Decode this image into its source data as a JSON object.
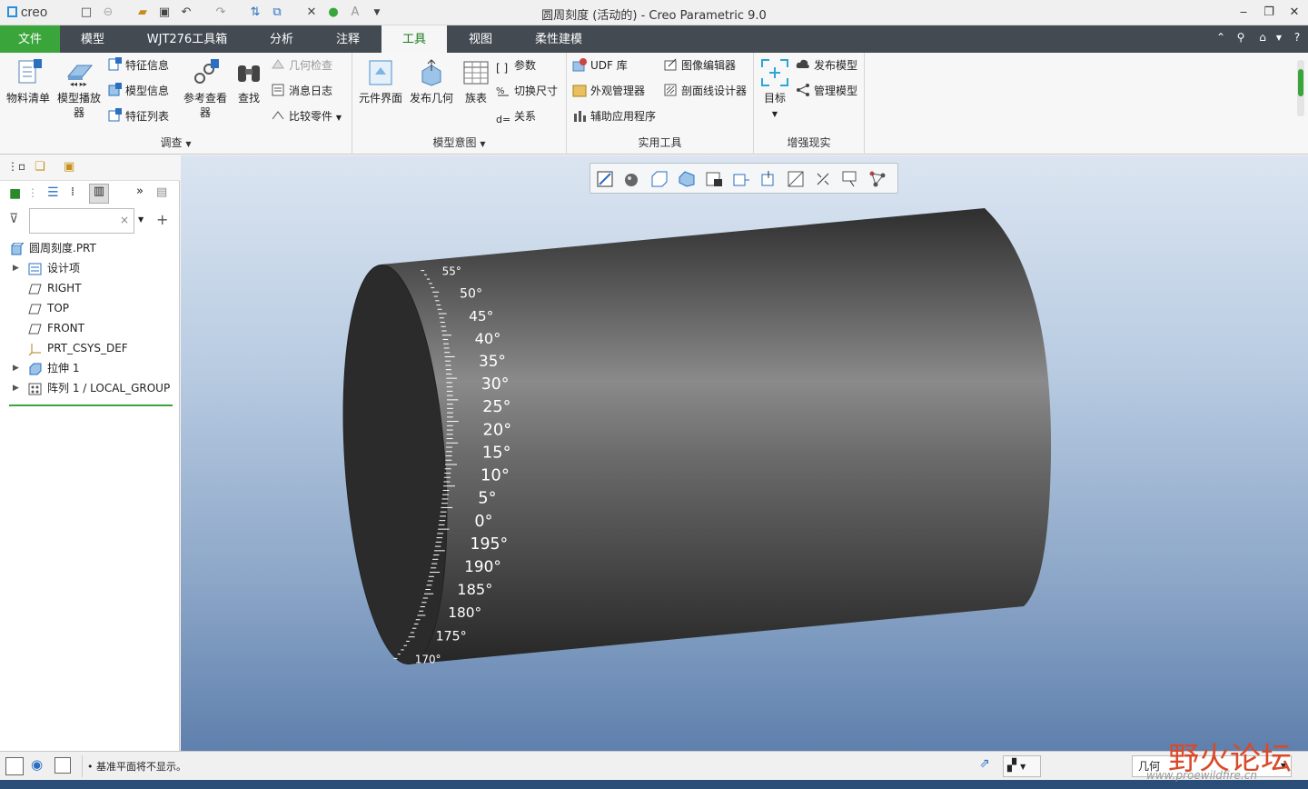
{
  "titlebar": {
    "logo": "creo",
    "title": "圆周刻度 (活动的) - Creo Parametric 9.0"
  },
  "tabs": [
    "文件",
    "模型",
    "WJT276工具箱",
    "分析",
    "注释",
    "工具",
    "视图",
    "柔性建模"
  ],
  "ribbon": {
    "investigate": {
      "label": "调查",
      "bom": "物料清单",
      "player": "模型播放器",
      "feature_info": "特征信息",
      "model_info": "模型信息",
      "feature_list": "特征列表",
      "ref_viewer": "参考查看器",
      "find": "查找",
      "geom_check": "几何检查",
      "msg_log": "消息日志",
      "compare": "比较零件"
    },
    "model_intent": {
      "label": "模型意图",
      "component_interface": "元件界面",
      "publish_geom": "发布几何",
      "family_table": "族表",
      "params": "参数",
      "switch_dims": "切换尺寸",
      "relations": "关系"
    },
    "utilities": {
      "label": "实用工具",
      "udf": "UDF 库",
      "appearance": "外观管理器",
      "aux_apps": "辅助应用程序",
      "image_editor": "图像编辑器",
      "xhatch": "剖面线设计器"
    },
    "ar": {
      "label": "增强现实",
      "target": "目标",
      "publish_model": "发布模型",
      "manage_model": "管理模型"
    }
  },
  "tree": {
    "root": "圆周刻度.PRT",
    "items": [
      "设计项",
      "RIGHT",
      "TOP",
      "FRONT",
      "PRT_CSYS_DEF",
      "拉伸 1",
      "阵列 1 / LOCAL_GROUP"
    ]
  },
  "scale": {
    "labels": [
      "55°",
      "50°",
      "45°",
      "40°",
      "35°",
      "30°",
      "25°",
      "20°",
      "15°",
      "10°",
      "5°",
      "0°",
      "195°",
      "190°",
      "185°",
      "180°",
      "175°",
      "170°"
    ]
  },
  "status": {
    "message": "基准平面将不显示。",
    "filter": "几何"
  },
  "watermark": {
    "text": "野火论坛",
    "url": "www.proewildfire.cn"
  },
  "colors": {
    "accent": "#3aa53a",
    "tabbar": "#434a52",
    "viewport_top": "#dbe5f1",
    "viewport_bottom": "#5f80ad",
    "cylinder": "#4a4a4a"
  }
}
